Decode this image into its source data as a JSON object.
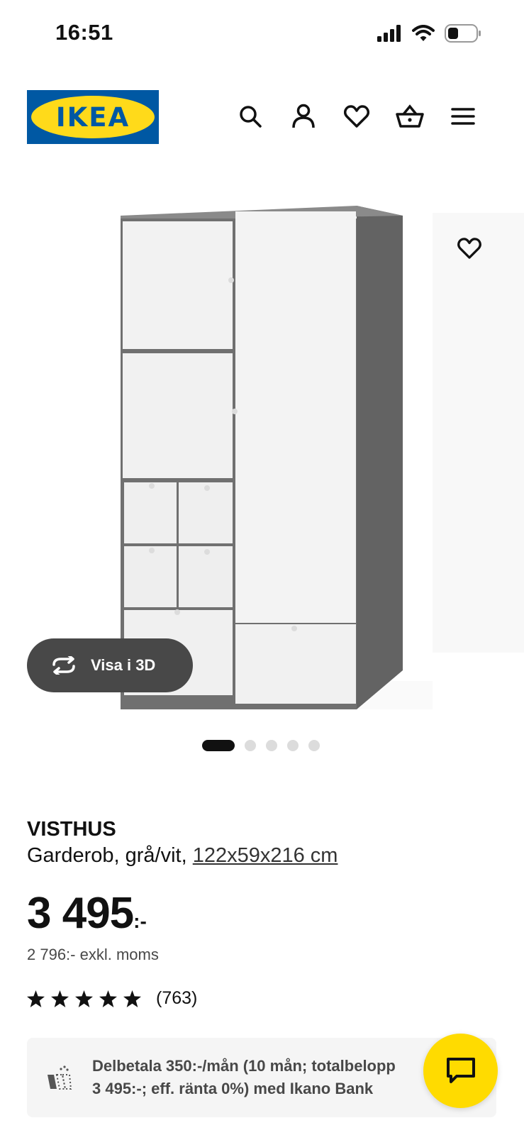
{
  "status_bar": {
    "time": "16:51",
    "icons": [
      "signal-icon",
      "wifi-icon",
      "battery-icon"
    ]
  },
  "header": {
    "logo_text": "IKEA",
    "logo_colors": {
      "background": "#0058a3",
      "ellipse": "#ffda1a"
    },
    "icons": [
      "search-icon",
      "account-icon",
      "heart-icon",
      "basket-icon",
      "menu-icon"
    ]
  },
  "gallery": {
    "favorite_icon": "heart-icon",
    "view_3d_label": "Visa i 3D",
    "slides_total": 5,
    "active_slide": 1
  },
  "product": {
    "name": "VISTHUS",
    "description_prefix": "Garderob, grå/vit, ",
    "dimensions": "122x59x216 cm",
    "price": "3 495",
    "price_suffix": ":-",
    "price_excl": "2 796:- exkl. moms",
    "rating_stars": 5,
    "rating_count": "(763)"
  },
  "finance": {
    "line1": "Delbetala 350:-/mån (10 mån; totalbelopp",
    "line2": "3 495:-; eff. ränta 0%) med Ikano Bank"
  },
  "colors": {
    "accent_yellow": "#ffdb00",
    "dark_pill": "#484848"
  }
}
